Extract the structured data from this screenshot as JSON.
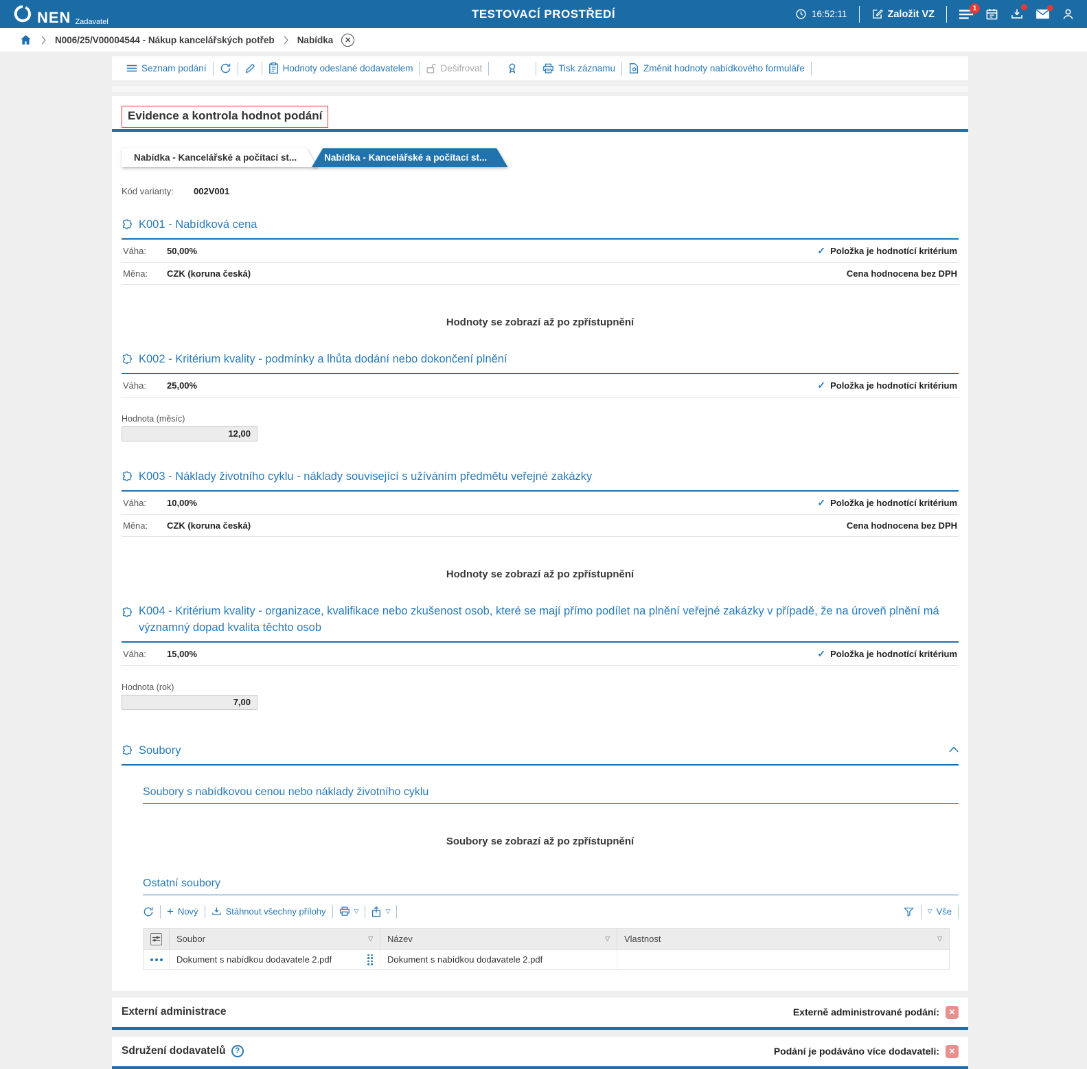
{
  "topbar": {
    "brand": "NEN",
    "brand_sub": "Zadavatel",
    "environment": "TESTOVACÍ PROSTŘEDÍ",
    "time": "16:52:11",
    "new_vz_label": "Založit VZ",
    "menu_badge": "1"
  },
  "breadcrumb": {
    "item1": "N006/25/V00004544 - Nákup kancelářských potřeb",
    "item2": "Nabídka"
  },
  "toolbar": {
    "list_label": "Seznam podání",
    "values_sent_label": "Hodnoty odeslané dodavatelem",
    "decrypt_label": "Dešifrovat",
    "print_label": "Tisk záznamu",
    "change_values_label": "Změnit hodnoty nabídkového formuláře"
  },
  "main": {
    "title": "Evidence a kontrola hodnot podání",
    "tabs": [
      {
        "label": "Nabídka - Kancelářské a počítací st..."
      },
      {
        "label": "Nabídka - Kancelářské a počítací st..."
      }
    ],
    "variant_code_label": "Kód varianty:",
    "variant_code": "002V001",
    "weight_label": "Váha:",
    "currency_label": "Měna:",
    "criterion_flag": "Položka je hodnotící kritérium",
    "no_vat_label": "Cena hodnocena bez DPH",
    "values_placeholder": "Hodnoty se zobrazí až po zpřístupnění",
    "files_placeholder": "Soubory se zobrazí až po zpřístupnění",
    "criteria": [
      {
        "title": "K001 - Nabídková cena",
        "weight": "50,00%",
        "currency": "CZK (koruna česká)"
      },
      {
        "title": "K002 - Kritérium kvality - podmínky a lhůta dodání nebo dokončení plnění",
        "weight": "25,00%",
        "field_label": "Hodnota (měsíc)",
        "field_value": "12,00"
      },
      {
        "title": "K003 - Náklady životního cyklu - náklady související s užíváním předmětu veřejné zakázky",
        "weight": "10,00%",
        "currency": "CZK (koruna česká)"
      },
      {
        "title": "K004 - Kritérium kvality - organizace, kvalifikace nebo zkušenost osob, které se mají přímo podílet na plnění veřejné zakázky v případě, že na úroveň plnění má významný dopad kvalita těchto osob",
        "weight": "15,00%",
        "field_label": "Hodnota (rok)",
        "field_value": "7,00"
      }
    ],
    "files": {
      "title": "Soubory",
      "subsection_price_files": "Soubory s nabídkovou cenou nebo náklady životního cyklu",
      "subsection_other_files": "Ostatní soubory",
      "toolbar": {
        "new_label": "Nový",
        "download_all_label": "Stáhnout všechny přílohy",
        "all_label": "Vše"
      },
      "table": {
        "columns": [
          "Soubor",
          "Název",
          "Vlastnost"
        ],
        "rows": [
          {
            "file": "Dokument s nabídkou dodavatele 2.pdf",
            "name": "Dokument s nabídkou dodavatele 2.pdf",
            "property": ""
          }
        ]
      }
    }
  },
  "footer": {
    "external_admin_title": "Externí administrace",
    "external_admin_label": "Externě administrované podání:",
    "suppliers_group_title": "Sdružení dodavatelů",
    "suppliers_group_label": "Podání je podáváno více dodavateli:"
  },
  "colors": {
    "topbar_blue": "#1b6ba5",
    "accent_blue": "#1d70ad",
    "link_blue": "#2779b8",
    "badge_red": "#e53935",
    "flag_red": "#e88f8f",
    "title_border_red": "#e03131"
  }
}
